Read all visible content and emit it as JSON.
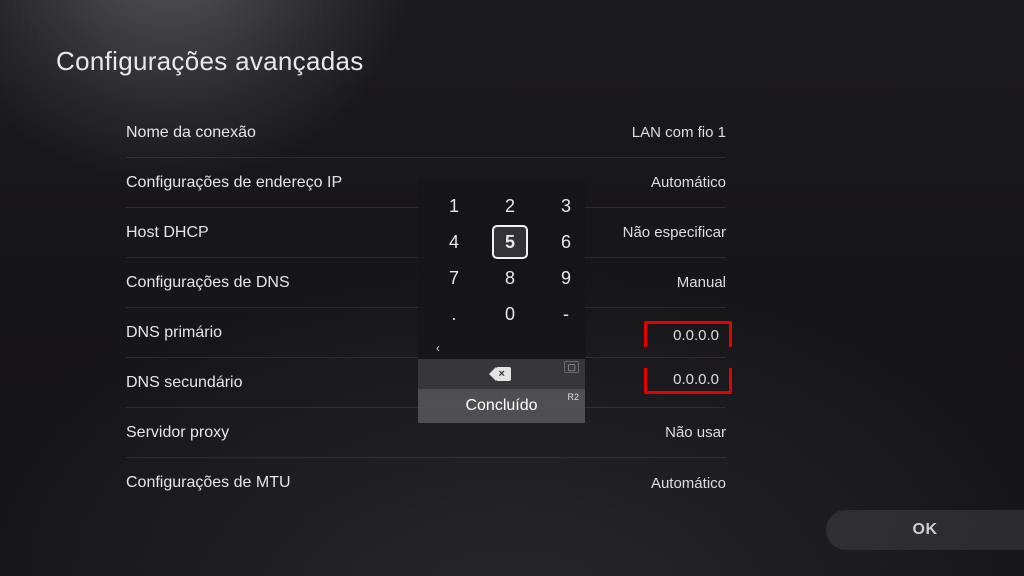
{
  "title": "Configurações avançadas",
  "rows": {
    "connection_name": {
      "label": "Nome da conexão",
      "value": "LAN com fio 1"
    },
    "ip_settings": {
      "label": "Configurações de endereço IP",
      "value": "Automático"
    },
    "dhcp_host": {
      "label": "Host DHCP",
      "value": "Não especificar"
    },
    "dns_settings": {
      "label": "Configurações de DNS",
      "value": "Manual"
    },
    "primary_dns": {
      "label": "DNS primário",
      "value": "0.0.0.0"
    },
    "secondary_dns": {
      "label": "DNS secundário",
      "value": "0.0.0.0"
    },
    "proxy": {
      "label": "Servidor proxy",
      "value": "Não usar"
    },
    "mtu": {
      "label": "Configurações de MTU",
      "value": "Automático"
    }
  },
  "keypad": {
    "keys": [
      "1",
      "2",
      "3",
      "4",
      "5",
      "6",
      "7",
      "8",
      "9",
      ".",
      "0",
      "-"
    ],
    "selected": "5",
    "done_label": "Concluído",
    "backspace_hint": "▢",
    "done_hint": "R2",
    "arrow_left": "‹",
    "arrow_right": " "
  },
  "ok_label": "OK"
}
